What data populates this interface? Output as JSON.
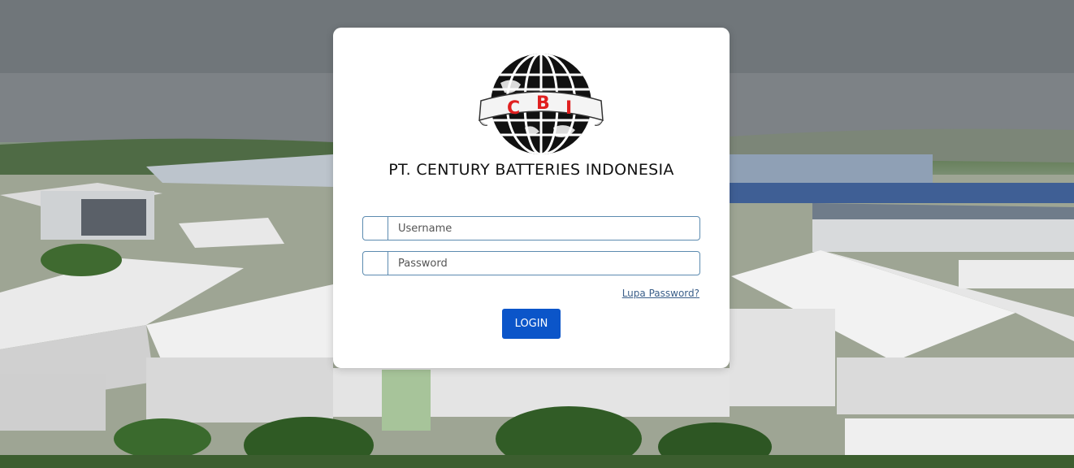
{
  "company": {
    "name": "PT. CENTURY BATTERIES INDONESIA",
    "logo_letters": [
      "C",
      "B",
      "I"
    ]
  },
  "form": {
    "username_placeholder": "Username",
    "password_placeholder": "Password",
    "username_icon": "user-icon",
    "password_icon": "lock-icon",
    "icon_glyph": "",
    "forgot_label": "Lupa Password?",
    "login_label": "LOGIN"
  },
  "colors": {
    "button": "#0b55c9",
    "field_border": "#5c8bb0",
    "logo_letters": "#e02020",
    "link": "#3b5f8a"
  }
}
